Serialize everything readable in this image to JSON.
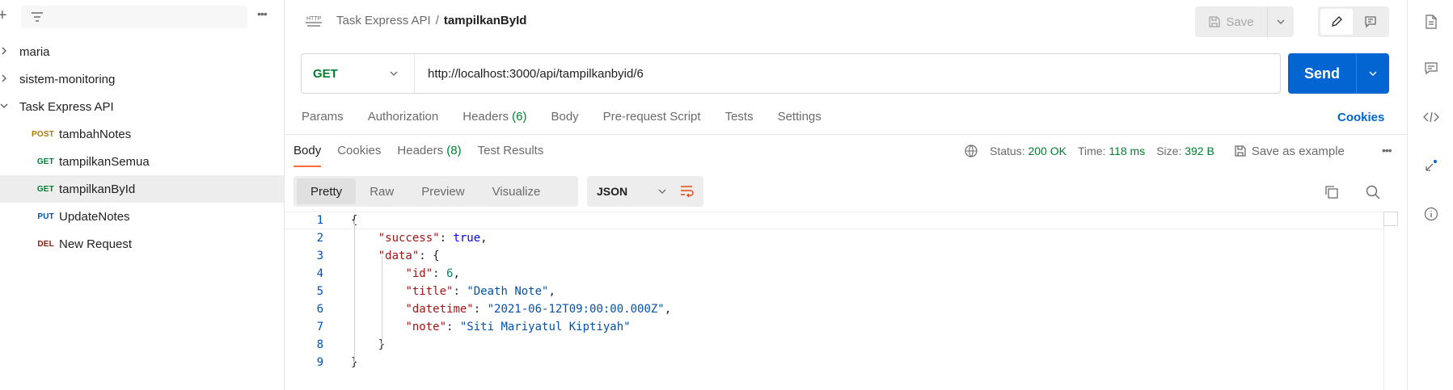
{
  "sidebar": {
    "items": [
      {
        "label": "maria",
        "type": "collection"
      },
      {
        "label": "sistem-monitoring",
        "type": "collection"
      },
      {
        "label": "Task Express API",
        "type": "collection"
      }
    ],
    "requests": [
      {
        "method": "POST",
        "label": "tambahNotes"
      },
      {
        "method": "GET",
        "label": "tampilkanSemua"
      },
      {
        "method": "GET",
        "label": "tampilkanById"
      },
      {
        "method": "PUT",
        "label": "UpdateNotes"
      },
      {
        "method": "DEL",
        "label": "New Request"
      }
    ]
  },
  "header": {
    "icon_text": "HTTP",
    "collection": "Task Express API",
    "separator": "/",
    "request": "tampilkanById",
    "save_label": "Save"
  },
  "request": {
    "method": "GET",
    "url": "http://localhost:3000/api/tampilkanbyid/6",
    "send_label": "Send",
    "tabs": [
      {
        "label": "Params"
      },
      {
        "label": "Authorization"
      },
      {
        "label": "Headers",
        "count": "(6)"
      },
      {
        "label": "Body"
      },
      {
        "label": "Pre-request Script"
      },
      {
        "label": "Tests"
      },
      {
        "label": "Settings"
      }
    ],
    "cookies_label": "Cookies"
  },
  "response": {
    "tabs": [
      {
        "label": "Body"
      },
      {
        "label": "Cookies"
      },
      {
        "label": "Headers",
        "count": "(8)"
      },
      {
        "label": "Test Results"
      }
    ],
    "status_label": "Status:",
    "status_value": "200 OK",
    "time_label": "Time:",
    "time_value": "118 ms",
    "size_label": "Size:",
    "size_value": "392 B",
    "save_example_label": "Save as example",
    "views": [
      "Pretty",
      "Raw",
      "Preview",
      "Visualize"
    ],
    "format": "JSON",
    "body": {
      "success_key": "\"success\"",
      "success_value": "true",
      "data_key": "\"data\"",
      "id_key": "\"id\"",
      "id_value": "6",
      "title_key": "\"title\"",
      "title_value": "\"Death Note\"",
      "datetime_key": "\"datetime\"",
      "datetime_value": "\"2021-06-12T09:00:00.000Z\"",
      "note_key": "\"note\"",
      "note_value": "\"Siti Mariyatul Kiptiyah\""
    },
    "line_numbers": [
      "1",
      "2",
      "3",
      "4",
      "5",
      "6",
      "7",
      "8",
      "9"
    ]
  }
}
